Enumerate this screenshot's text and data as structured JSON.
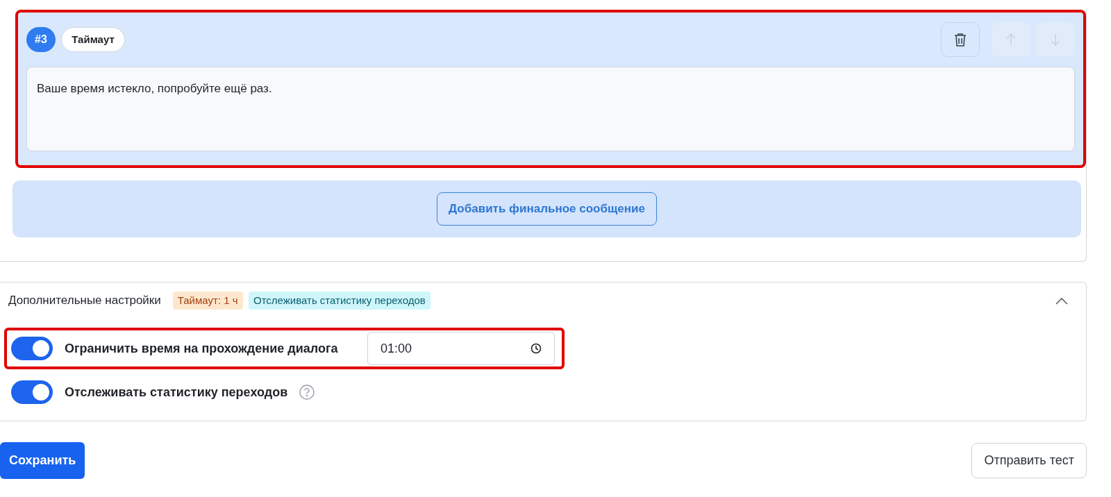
{
  "message": {
    "number": "#3",
    "type_label": "Таймаут",
    "text": "Ваше время истекло, попробуйте ещё раз.",
    "highlighted": true,
    "actions": [
      {
        "kind": "delete",
        "disabled": false
      },
      {
        "kind": "up",
        "disabled": true
      },
      {
        "kind": "down",
        "disabled": true
      }
    ]
  },
  "add_button": "Добавить финальное сообщение",
  "settings": {
    "title": "Дополнительные настройки",
    "expanded": true,
    "tags": [
      {
        "label": "Таймаут: 1 ч",
        "kind": "warning"
      },
      {
        "label": "Отслеживать статистику переходов",
        "kind": "info"
      }
    ],
    "options": [
      {
        "label": "Ограничить время на прохождение диалога",
        "on": true,
        "highlighted": true,
        "time": "01:00",
        "help": false
      },
      {
        "label": "Отслеживать статистику переходов",
        "on": true,
        "highlighted": false,
        "help": true
      }
    ]
  },
  "footer": {
    "save": "Сохранить",
    "test": "Отправить тест"
  }
}
